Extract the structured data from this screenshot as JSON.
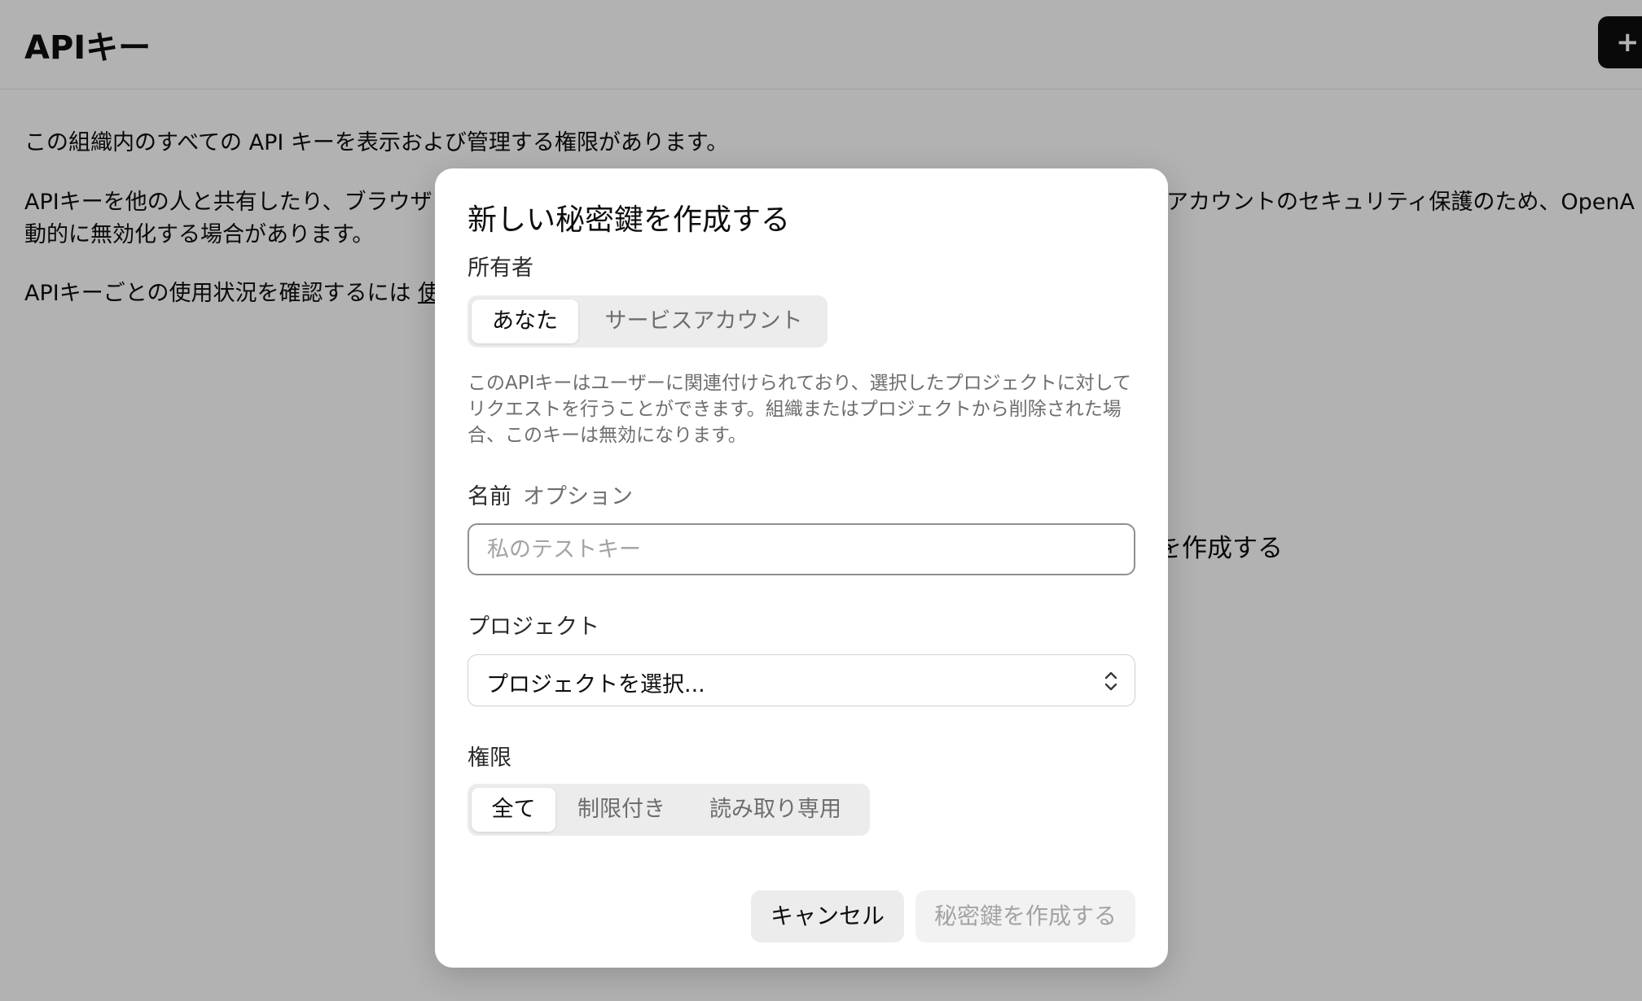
{
  "page": {
    "title": "APIキー",
    "create_icon": "plus-icon",
    "create_symbol": "+",
    "paragraph1": "この組織内のすべての API キーを表示および管理する権限があります。",
    "paragraph2_start": "APIキーを他の人と共有したり、ブラウザ",
    "paragraph2_end": "アカウントのセキュリティ保護のため、OpenA",
    "paragraph2_line2": "動的に無効化する場合があります。",
    "paragraph3_prefix": "APIキーごとの使用状況を確認するには",
    "paragraph3_link": "使",
    "behind_modal_cta": "を作成する"
  },
  "modal": {
    "title": "新しい秘密鍵を作成する",
    "owner": {
      "label": "所有者",
      "options": [
        "あなた",
        "サービスアカウント"
      ],
      "selected": "あなた"
    },
    "help_text": "このAPIキーはユーザーに関連付けられており、選択したプロジェクトに対してリクエストを行うことができます。組織またはプロジェクトから削除された場合、このキーは無効になります。",
    "name": {
      "label": "名前",
      "optional": "オプション",
      "placeholder": "私のテストキー",
      "value": ""
    },
    "project": {
      "label": "プロジェクト",
      "value": "プロジェクトを選択...",
      "icon": "chevron-updown-icon"
    },
    "permissions": {
      "label": "権限",
      "options": [
        "全て",
        "制限付き",
        "読み取り専用"
      ],
      "selected": "全て"
    },
    "buttons": {
      "cancel": "キャンセル",
      "create": "秘密鍵を作成する"
    }
  }
}
